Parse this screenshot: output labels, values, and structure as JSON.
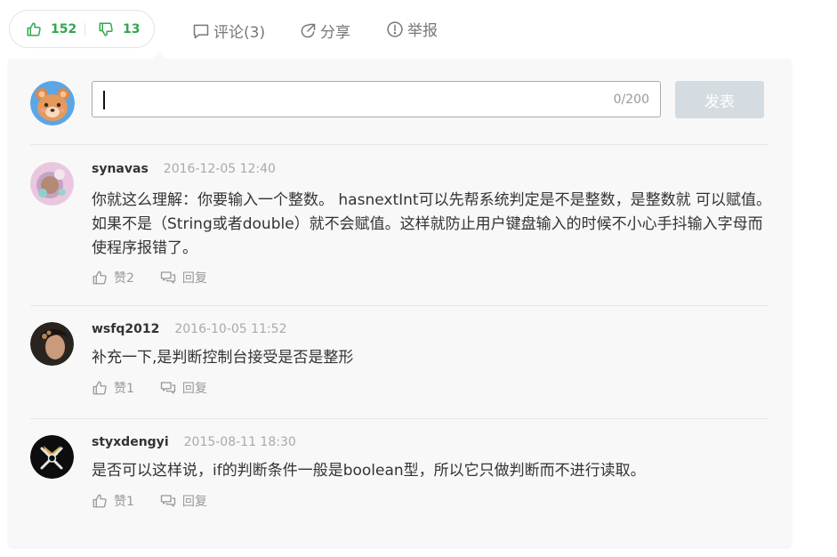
{
  "votes": {
    "up_count": "152",
    "down_count": "13"
  },
  "actions": {
    "comment": "评论(3)",
    "share": "分享",
    "report": "举报"
  },
  "composer": {
    "counter": "0/200",
    "submit": "发表"
  },
  "comments": [
    {
      "user": "synavas",
      "time": "2016-12-05 12:40",
      "text": "你就这么理解：你要输入一个整数。 hasnextInt可以先帮系统判定是不是整数，是整数就 可以赋值。如果不是（String或者double）就不会赋值。这样就防止用户键盘输入的时候不小心手抖输入字母而使程序报错了。",
      "like": "赞2",
      "reply": "回复"
    },
    {
      "user": "wsfq2012",
      "time": "2016-10-05 11:52",
      "text": "补充一下,是判断控制台接受是否是整形",
      "like": "赞1",
      "reply": "回复"
    },
    {
      "user": "styxdengyi",
      "time": "2015-08-11 18:30",
      "text": "是否可以这样说，if的判断条件一般是boolean型，所以它只做判断而不进行读取。",
      "like": "赞1",
      "reply": "回复"
    }
  ],
  "colors": {
    "accent_green": "#2fa84f",
    "submit_disabled": "#d4dce1",
    "panel_bg": "#f8f8f8"
  }
}
